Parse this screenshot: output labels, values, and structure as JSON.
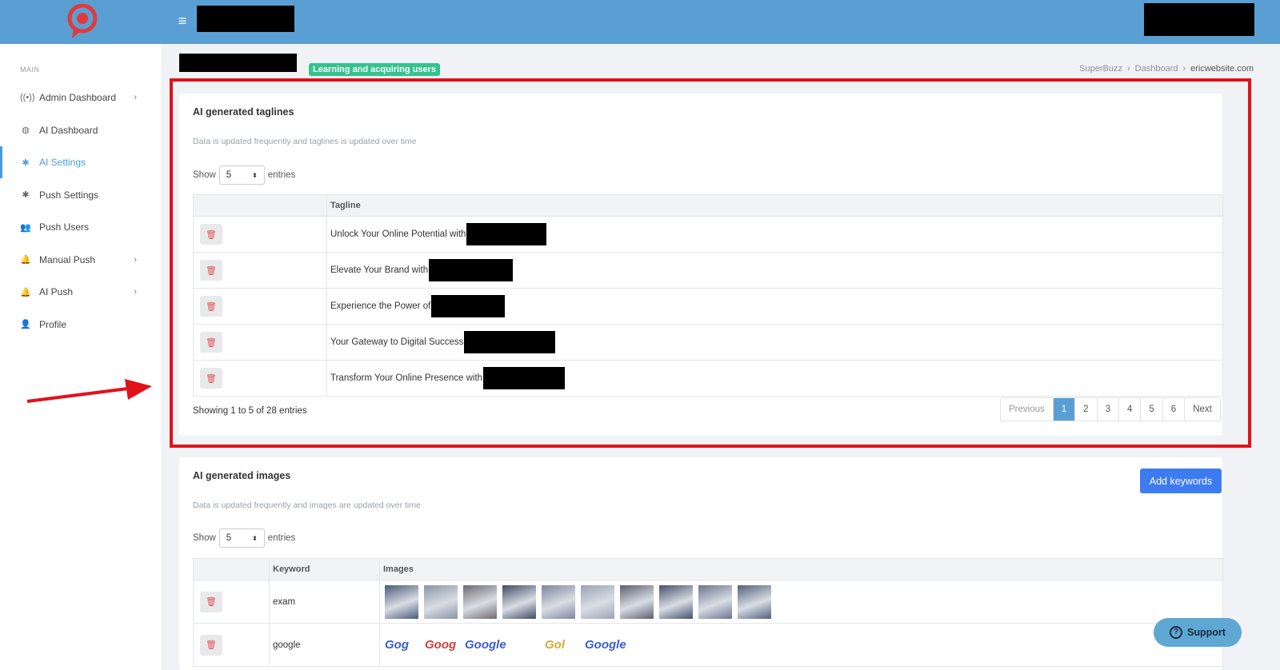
{
  "topbar": {
    "menu_icon": "hamburger-icon",
    "fullscreen_icon": "fullscreen-icon"
  },
  "sidebar": {
    "heading": "MAIN",
    "items": [
      {
        "label": "Admin Dashboard",
        "icon": "broadcast-icon",
        "glyph": "((•))",
        "chevron": true
      },
      {
        "label": "AI Dashboard",
        "icon": "globe-icon",
        "glyph": "◍",
        "chevron": false
      },
      {
        "label": "AI Settings",
        "icon": "gear-icon",
        "glyph": "✱",
        "chevron": false,
        "active": true
      },
      {
        "label": "Push Settings",
        "icon": "gear-icon",
        "glyph": "✱",
        "chevron": false
      },
      {
        "label": "Push Users",
        "icon": "users-icon",
        "glyph": "👥",
        "chevron": false
      },
      {
        "label": "Manual Push",
        "icon": "bell-icon",
        "glyph": "🔔",
        "chevron": true
      },
      {
        "label": "AI Push",
        "icon": "robot-icon",
        "glyph": "🔔",
        "chevron": true
      },
      {
        "label": "Profile",
        "icon": "user-icon",
        "glyph": "👤",
        "chevron": false
      }
    ]
  },
  "header": {
    "badge": "Learning and acquiring users",
    "breadcrumb": [
      "SuperBuzz",
      "Dashboard",
      "ericwebsite.com"
    ]
  },
  "taglines": {
    "title": "AI generated taglines",
    "subtitle": "Data is updated frequently and taglines is updated over time",
    "show_label": "Show",
    "entries_label": "entries",
    "page_size": "5",
    "column": "Tagline",
    "rows": [
      "Unlock Your Online Potential with",
      "Elevate Your Brand with",
      "Experience the Power of",
      "Your Gateway to Digital Success",
      "Transform Your Online Presence with"
    ],
    "showing": "Showing 1 to 5 of 28 entries",
    "pager": [
      "Previous",
      "1",
      "2",
      "3",
      "4",
      "5",
      "6",
      "Next"
    ]
  },
  "images": {
    "title": "AI generated images",
    "subtitle": "Data is updated frequently and images are updated over time",
    "add_button": "Add keywords",
    "show_label": "Show",
    "entries_label": "entries",
    "page_size": "5",
    "col_keyword": "Keyword",
    "col_images": "Images",
    "rows": [
      {
        "keyword": "exam"
      },
      {
        "keyword": "google",
        "thumb_texts": [
          "Gog",
          "Goog",
          "Google",
          "",
          "Gol",
          "Google"
        ]
      }
    ]
  },
  "support": {
    "label": "Support"
  },
  "colors": {
    "topbar": "#5a9fd4",
    "accent": "#4a9be0",
    "badge": "#34c38f",
    "highlight": "#e0121a"
  }
}
